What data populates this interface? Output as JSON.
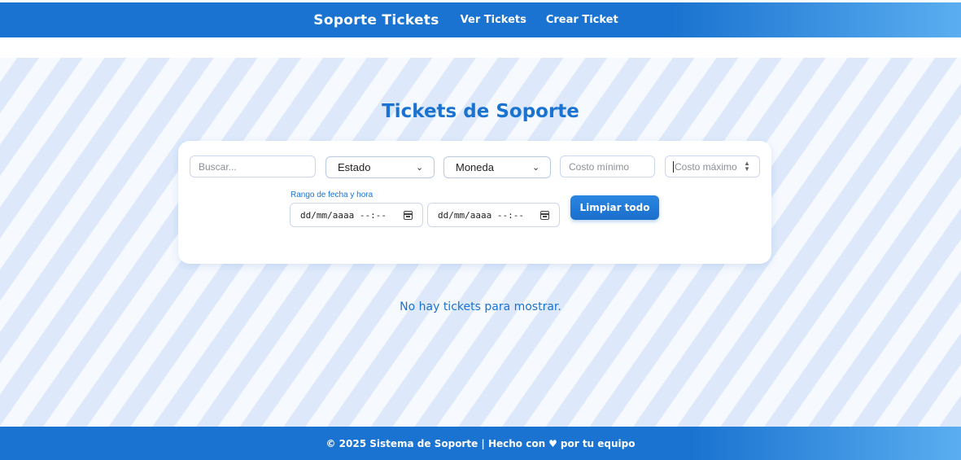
{
  "navbar": {
    "brand": "Soporte Tickets",
    "links": [
      "Ver Tickets",
      "Crear Ticket"
    ]
  },
  "main": {
    "title": "Tickets de Soporte",
    "empty_message": "No hay tickets para mostrar."
  },
  "filters": {
    "search_placeholder": "Buscar...",
    "status_select": "Estado",
    "currency_select": "Moneda",
    "min_cost_placeholder": "Costo mínimo",
    "max_cost_placeholder": "Costo máximo",
    "date_range_label": "Rango de fecha y hora",
    "date_from_placeholder": "dd/mm/aaaa --:--",
    "date_to_placeholder": "dd/mm/aaaa --:--",
    "clear_button": "Limpiar todo"
  },
  "footer": {
    "text_before": "© 2025 Sistema de Soporte | Hecho con",
    "heart": "♥",
    "text_after": "por tu equipo"
  },
  "colors": {
    "primary": "#1a73d0",
    "primary_light": "#5aaef0",
    "stripe": "#dde9fb"
  }
}
